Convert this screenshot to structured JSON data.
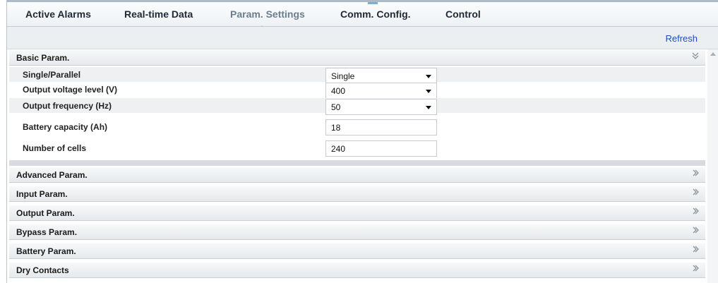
{
  "tabs": [
    {
      "label": "Active Alarms",
      "active": false
    },
    {
      "label": "Real-time Data",
      "active": false
    },
    {
      "label": "Param. Settings",
      "active": true
    },
    {
      "label": "Comm. Config.",
      "active": false
    },
    {
      "label": "Control",
      "active": false
    }
  ],
  "toolbar": {
    "refresh_label": "Refresh"
  },
  "sections": [
    {
      "label": "Basic Param.",
      "expanded": true,
      "icon": "chevrons-down-icon"
    },
    {
      "label": "Advanced Param.",
      "expanded": false,
      "icon": "chevrons-right-icon"
    },
    {
      "label": "Input Param.",
      "expanded": false,
      "icon": "chevrons-right-icon"
    },
    {
      "label": "Output Param.",
      "expanded": false,
      "icon": "chevrons-right-icon"
    },
    {
      "label": "Bypass Param.",
      "expanded": false,
      "icon": "chevrons-right-icon"
    },
    {
      "label": "Battery Param.",
      "expanded": false,
      "icon": "chevrons-right-icon"
    },
    {
      "label": "Dry Contacts",
      "expanded": false,
      "icon": "chevrons-right-icon"
    }
  ],
  "basic_params": [
    {
      "label": "Single/Parallel",
      "value": "Single",
      "type": "select"
    },
    {
      "label": "Output voltage level (V)",
      "value": "400",
      "type": "select"
    },
    {
      "label": "Output frequency (Hz)",
      "value": "50",
      "type": "select"
    },
    {
      "label": "Battery capacity (Ah)",
      "value": "18",
      "type": "text"
    },
    {
      "label": "Number of cells",
      "value": "240",
      "type": "text"
    }
  ],
  "colors": {
    "active_tab": "#6b7d8f",
    "link": "#1f4fb5",
    "header_band": "#eceff2"
  }
}
